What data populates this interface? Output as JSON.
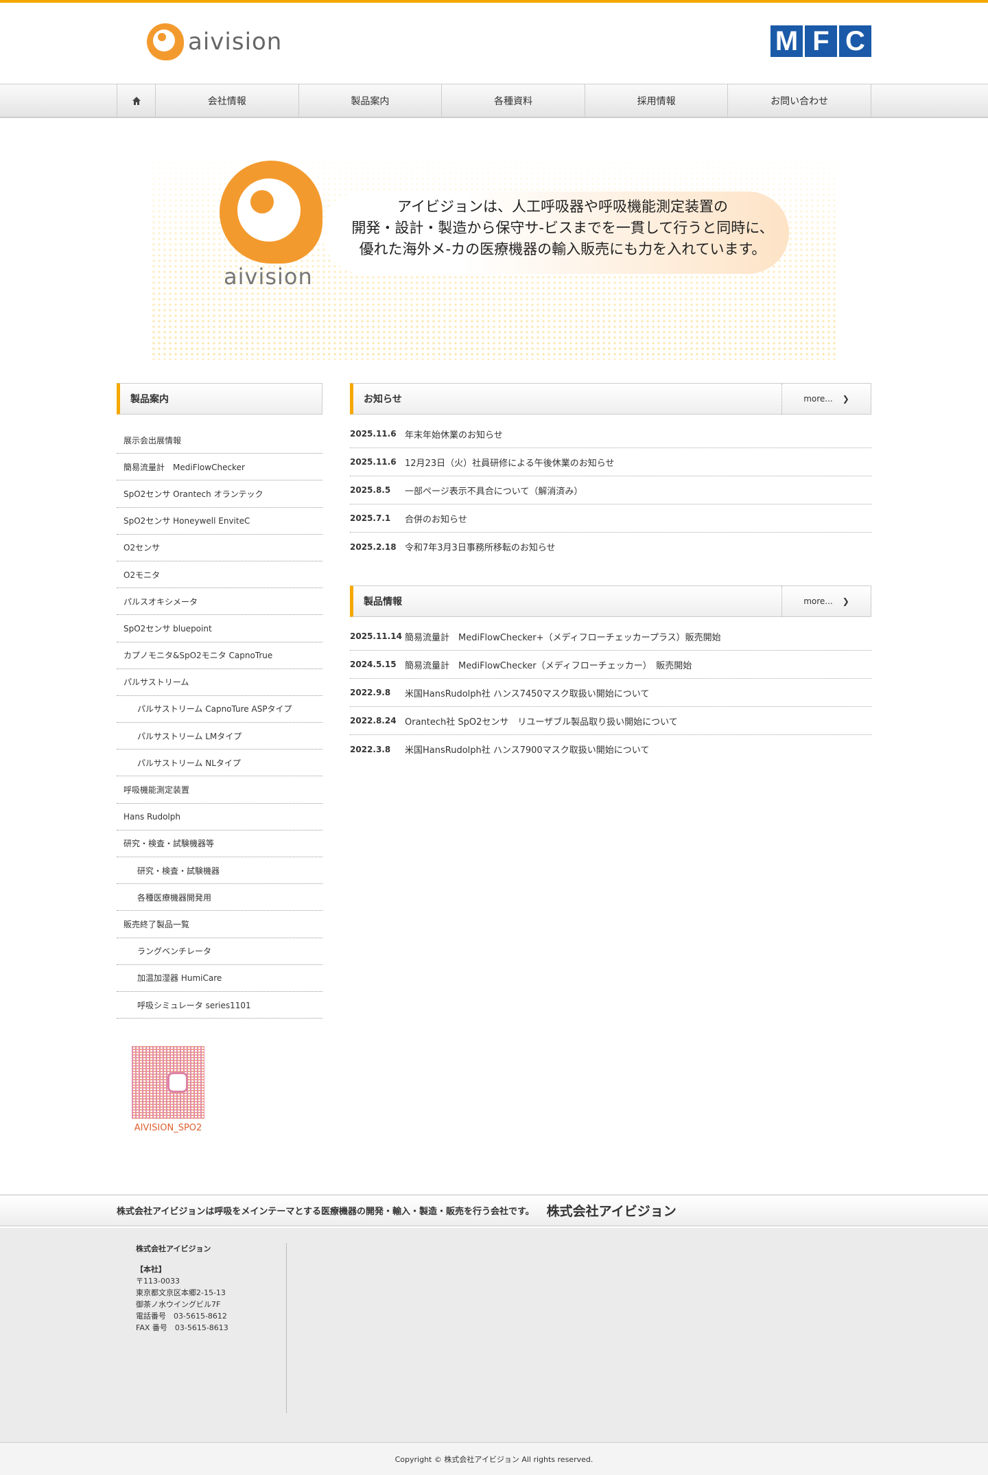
{
  "header": {
    "logo_text": "aivision",
    "partner_logo": [
      "M",
      "F",
      "C"
    ]
  },
  "nav": {
    "items": [
      "会社情報",
      "製品案内",
      "各種資料",
      "採用情報",
      "お問い合わせ"
    ]
  },
  "hero": {
    "logo_text": "aivision",
    "lines": [
      "アイビジョンは、人工呼吸器や呼吸機能測定装置の",
      "開発・設計・製造から保守サ-ビスまでを一貫して行うと同時に、",
      "優れた海外メ-カの医療機器の輸入販売にも力を入れています。"
    ]
  },
  "sidebar": {
    "title": "製品案内",
    "items": [
      {
        "label": "展示会出展情報",
        "sub": false
      },
      {
        "label": "簡易流量計　MediFlowChecker",
        "sub": false
      },
      {
        "label": "SpO2センサ Orantech オランテック",
        "sub": false
      },
      {
        "label": "SpO2センサ Honeywell EnviteC",
        "sub": false
      },
      {
        "label": "O2センサ",
        "sub": false
      },
      {
        "label": "O2モニタ",
        "sub": false
      },
      {
        "label": "パルスオキシメータ",
        "sub": false
      },
      {
        "label": "SpO2センサ bluepoint",
        "sub": false
      },
      {
        "label": "カプノモニタ&SpO2モニタ CapnoTrue",
        "sub": false
      },
      {
        "label": "パルサストリーム",
        "sub": false
      },
      {
        "label": "パルサストリーム CapnoTure ASPタイプ",
        "sub": true
      },
      {
        "label": "パルサストリーム LMタイプ",
        "sub": true
      },
      {
        "label": "パルサストリーム NLタイプ",
        "sub": true
      },
      {
        "label": "呼吸機能測定装置",
        "sub": false
      },
      {
        "label": "Hans Rudolph",
        "sub": false
      },
      {
        "label": "研究・検査・試験機器等",
        "sub": false
      },
      {
        "label": "研究・検査・試験機器",
        "sub": true
      },
      {
        "label": "各種医療機器開発用",
        "sub": true
      },
      {
        "label": "販売終了製品一覧",
        "sub": false
      },
      {
        "label": "ラングベンチレータ",
        "sub": true
      },
      {
        "label": "加温加湿器 HumiCare",
        "sub": true
      },
      {
        "label": "呼吸シミュレータ series1101",
        "sub": true
      }
    ],
    "qr_label": "AIVISION_SPO2"
  },
  "news": {
    "title": "お知らせ",
    "more": "more...",
    "items": [
      {
        "date": "2025.11.6",
        "text": "年末年始休業のお知らせ"
      },
      {
        "date": "2025.11.6",
        "text": "12月23日（火）社員研修による午後休業のお知らせ"
      },
      {
        "date": "2025.8.5",
        "text": "一部ページ表示不具合について（解消済み）"
      },
      {
        "date": "2025.7.1",
        "text": "合併のお知らせ"
      },
      {
        "date": "2025.2.18",
        "text": "令和7年3月3日事務所移転のお知らせ"
      }
    ]
  },
  "products": {
    "title": "製品情報",
    "more": "more...",
    "items": [
      {
        "date": "2025.11.14",
        "text": "簡易流量計　MediFlowChecker+（メディフローチェッカープラス）販売開始"
      },
      {
        "date": "2024.5.15",
        "text": "簡易流量計　MediFlowChecker（メディフローチェッカー）　販売開始"
      },
      {
        "date": "2022.9.8",
        "text": "米国HansRudolph社 ハンス7450マスク取扱い開始について"
      },
      {
        "date": "2022.8.24",
        "text": "Orantech社 SpO2センサ　リユーザブル製品取り扱い開始について"
      },
      {
        "date": "2022.3.8",
        "text": "米国HansRudolph社 ハンス7900マスク取扱い開始について"
      }
    ]
  },
  "tagline": {
    "text": "株式会社アイビジョンは呼吸をメインテーマとする医療機器の開発・輸入・製造・販売を行う会社です。",
    "company": "株式会社アイビジョン"
  },
  "footer": {
    "company": "株式会社アイビジョン",
    "lines": [
      "【本社】",
      "〒113-0033",
      "東京都文京区本郷2-15-13",
      "御茶ノ水ウイングビル7F",
      "電話番号　03-5615-8612",
      "FAX 番号　03-5615-8613"
    ],
    "copyright": "Copyright ©  株式会社アイビジョン All rights reserved."
  }
}
